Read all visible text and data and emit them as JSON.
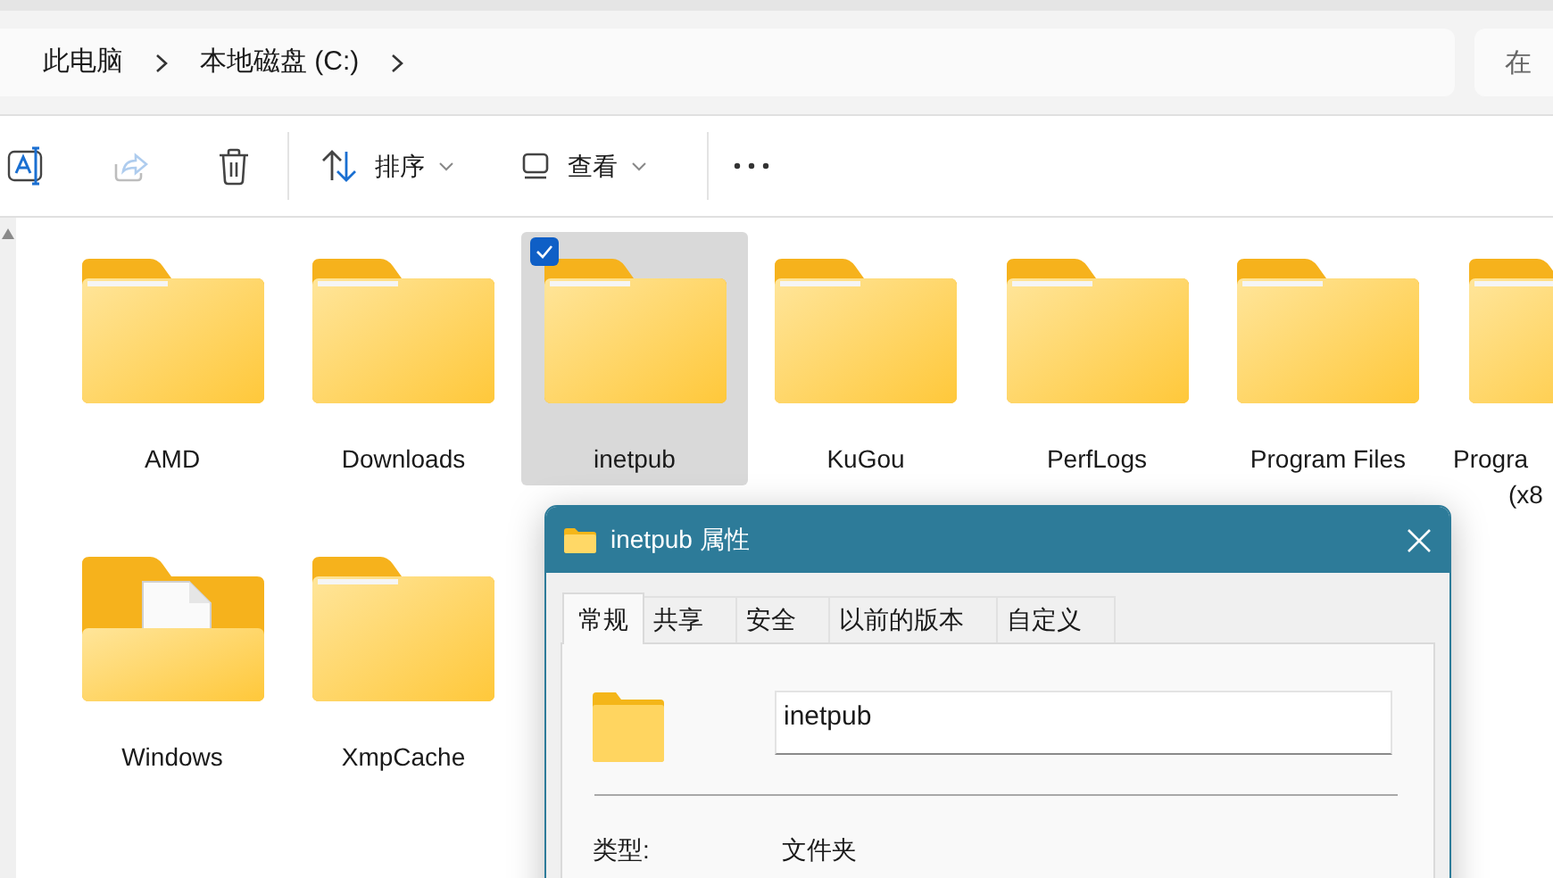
{
  "breadcrumbs": [
    "此电脑",
    "本地磁盘 (C:)"
  ],
  "search": {
    "placeholder": "在"
  },
  "toolbar": [
    {
      "kind": "rename",
      "disabled": false
    },
    {
      "kind": "share",
      "disabled": true
    },
    {
      "kind": "delete",
      "disabled": false
    },
    {
      "kind": "sort",
      "label": "排序",
      "disabled": false
    },
    {
      "kind": "view",
      "label": "查看",
      "disabled": false
    },
    {
      "kind": "more",
      "disabled": false
    }
  ],
  "items": [
    {
      "kind": "folder",
      "lines": [
        "AMD"
      ],
      "selected": false,
      "checked": false,
      "cut": false
    },
    {
      "kind": "folder",
      "lines": [
        "Downloads"
      ],
      "selected": false,
      "checked": false,
      "cut": false
    },
    {
      "kind": "folder",
      "lines": [
        "inetpub"
      ],
      "selected": true,
      "checked": true,
      "cut": false
    },
    {
      "kind": "folder",
      "lines": [
        "KuGou"
      ],
      "selected": false,
      "checked": false,
      "cut": false
    },
    {
      "kind": "folder",
      "lines": [
        "PerfLogs"
      ],
      "selected": false,
      "checked": false,
      "cut": false
    },
    {
      "kind": "folder",
      "lines": [
        "Program Files"
      ],
      "selected": false,
      "checked": false,
      "cut": false
    },
    {
      "kind": "folder",
      "lines": [
        "Progra",
        "(x8"
      ],
      "selected": false,
      "checked": false,
      "cut": true
    },
    {
      "kind": "document-folder",
      "lines": [
        "Windows"
      ],
      "selected": false,
      "checked": false,
      "cut": false
    },
    {
      "kind": "folder",
      "lines": [
        "XmpCache"
      ],
      "selected": false,
      "checked": false,
      "cut": false
    }
  ],
  "dialog": {
    "title": "inetpub 属性",
    "tabs": [
      {
        "label": "常规",
        "selected": true
      },
      {
        "label": "共享",
        "selected": false
      },
      {
        "label": "安全",
        "selected": false
      },
      {
        "label": "以前的版本",
        "selected": false
      },
      {
        "label": "自定义",
        "selected": false
      }
    ],
    "name_value": "inetpub",
    "properties": [
      {
        "label": "类型:",
        "value": "文件夹"
      }
    ]
  }
}
